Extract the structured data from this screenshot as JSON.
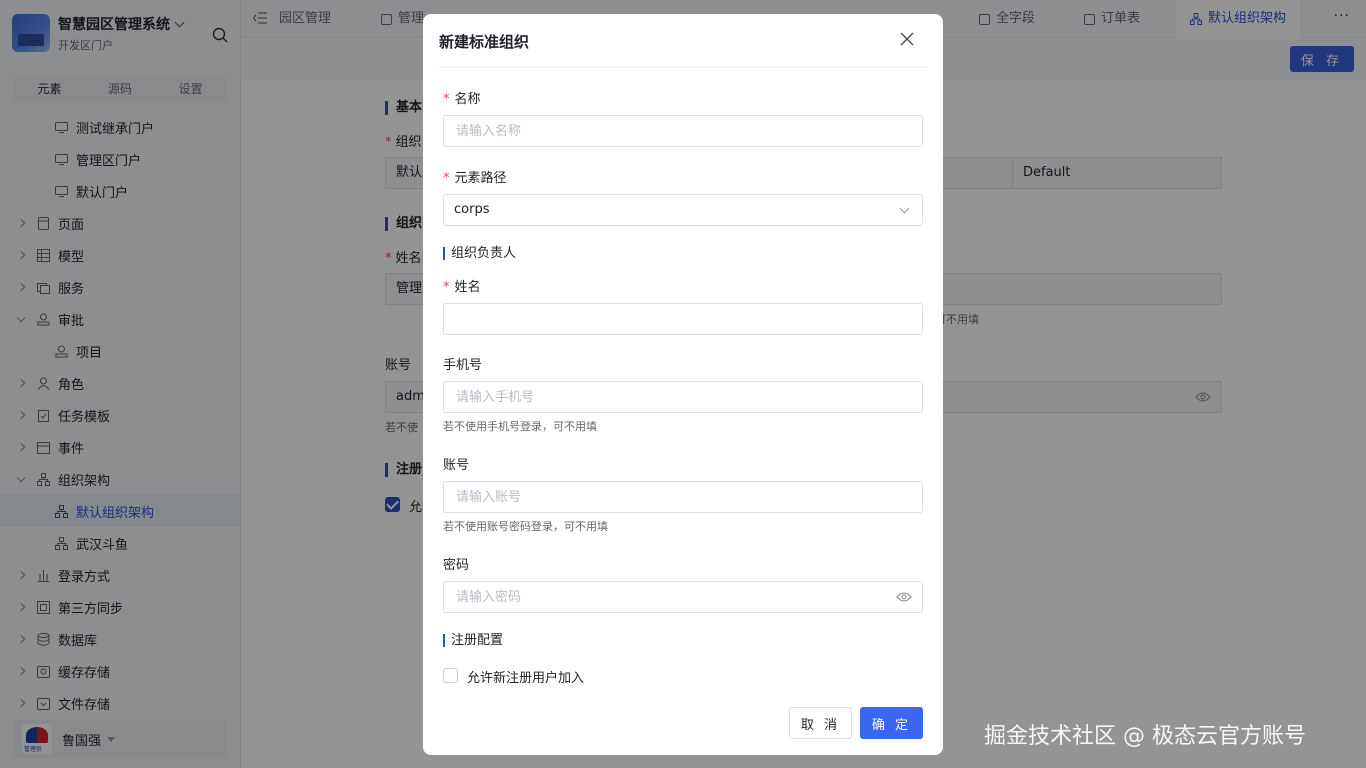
{
  "app": {
    "title": "智慧园区管理系统",
    "subtitle": "开发区门户"
  },
  "sidebar": {
    "tabs": [
      "元素",
      "源码",
      "设置"
    ],
    "items": [
      {
        "label": "测试继承门户",
        "icon": "portal-icon",
        "level": 1
      },
      {
        "label": "管理区门户",
        "icon": "portal-icon",
        "level": 1
      },
      {
        "label": "默认门户",
        "icon": "portal-icon",
        "level": 1
      },
      {
        "label": "页面",
        "icon": "page-icon",
        "level": 0
      },
      {
        "label": "模型",
        "icon": "table-icon",
        "level": 0
      },
      {
        "label": "服务",
        "icon": "service-icon",
        "level": 0
      },
      {
        "label": "审批",
        "icon": "approval-icon",
        "level": 0,
        "expanded": true
      },
      {
        "label": "项目",
        "icon": "approval-icon",
        "level": 1
      },
      {
        "label": "角色",
        "icon": "role-icon",
        "level": 0
      },
      {
        "label": "任务模板",
        "icon": "task-icon",
        "level": 0
      },
      {
        "label": "事件",
        "icon": "event-icon",
        "level": 0
      },
      {
        "label": "组织架构",
        "icon": "org-icon",
        "level": 0,
        "expanded": true
      },
      {
        "label": "默认组织架构",
        "icon": "org-icon",
        "level": 1,
        "active": true
      },
      {
        "label": "武汉斗鱼",
        "icon": "org-icon",
        "level": 1
      },
      {
        "label": "登录方式",
        "icon": "login-icon",
        "level": 0
      },
      {
        "label": "第三方同步",
        "icon": "sync-icon",
        "level": 0
      },
      {
        "label": "数据库",
        "icon": "database-icon",
        "level": 0
      },
      {
        "label": "缓存存储",
        "icon": "cache-icon",
        "level": 0
      },
      {
        "label": "文件存储",
        "icon": "file-storage-icon",
        "level": 0
      }
    ],
    "user": {
      "name": "鲁国强",
      "avatar_tag": "管理员"
    }
  },
  "tabs": [
    {
      "label": "园区管理"
    },
    {
      "label": "管理"
    },
    {
      "label": "全字段"
    },
    {
      "label": "订单表"
    },
    {
      "label": "默认组织架构",
      "active": true
    }
  ],
  "toolbar": {
    "save_label": "保 存",
    "more_label": "···"
  },
  "background_form": {
    "section_basic": "基本",
    "label_org": "组织",
    "org_value": "默认",
    "org_code": "Default",
    "section_owner": "组织",
    "label_name": "姓名",
    "name_value": "管理",
    "hint_phone_tail": "可不用填",
    "label_account": "账号",
    "account_value": "adm",
    "hint_account_head": "若不使",
    "section_register": "注册",
    "allow_head": "允"
  },
  "modal": {
    "title": "新建标准组织",
    "name_label": "名称",
    "name_placeholder": "请输入名称",
    "path_label": "元素路径",
    "path_value": "corps",
    "owner_section": "组织负责人",
    "person_label": "姓名",
    "phone_label": "手机号",
    "phone_placeholder": "请输入手机号",
    "phone_hint": "若不使用手机号登录，可不用填",
    "account_label": "账号",
    "account_placeholder": "请输入账号",
    "account_hint": "若不使用账号密码登录，可不用填",
    "password_label": "密码",
    "password_placeholder": "请输入密码",
    "register_section": "注册配置",
    "allow_register_label": "允许新注册用户加入",
    "allow_register_checked": false,
    "cancel_label": "取 消",
    "ok_label": "确 定"
  },
  "watermark": "掘金技术社区 @ 极态云官方账号",
  "colors": {
    "primary": "#3b66f0",
    "accent": "#2b50c7",
    "required": "#e54545"
  }
}
